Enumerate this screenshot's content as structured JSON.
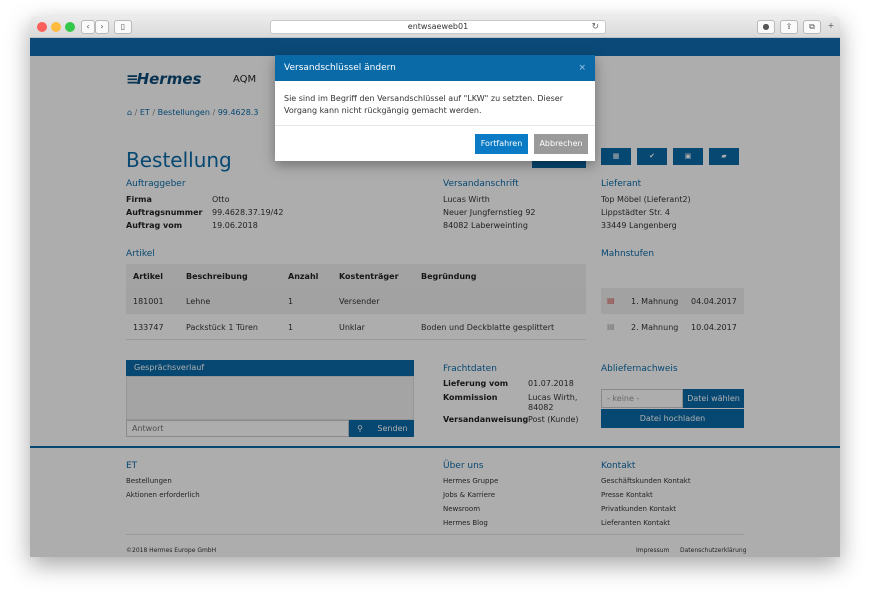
{
  "browser": {
    "url": "entwsaeweb01"
  },
  "header": {
    "logo": "Hermes",
    "app_name": "AQM"
  },
  "breadcrumb": {
    "items": [
      "ET",
      "/",
      "Bestellungen",
      "/",
      "99.4628.3"
    ]
  },
  "page": {
    "title": "Bestellung"
  },
  "auftraggeber": {
    "heading": "Auftraggeber",
    "rows": [
      {
        "label": "Firma",
        "value": "Otto"
      },
      {
        "label": "Auftragsnummer",
        "value": "99.4628.37.19/42"
      },
      {
        "label": "Auftrag vom",
        "value": "19.06.2018"
      }
    ]
  },
  "versandanschrift": {
    "heading": "Versandanschrift",
    "lines": [
      "Lucas Wirth",
      "Neuer Jungfernstieg 92",
      "84082 Laberweinting"
    ]
  },
  "lieferant": {
    "heading": "Lieferant",
    "lines": [
      "Top Möbel (Lieferant2)",
      "Lippstädter Str. 4",
      "33449 Langenberg"
    ]
  },
  "artikel": {
    "heading": "Artikel",
    "columns": [
      "Artikel",
      "Beschreibung",
      "Anzahl",
      "Kostenträger",
      "Begründung"
    ],
    "rows": [
      [
        "181001",
        "Lehne",
        "1",
        "Versender",
        ""
      ],
      [
        "133747",
        "Packstück 1 Türen",
        "1",
        "Unklar",
        "Boden und Deckblatte gesplittert"
      ]
    ]
  },
  "mahnstufen": {
    "heading": "Mahnstufen",
    "rows": [
      {
        "label": "1. Mahnung",
        "date": "04.04.2017"
      },
      {
        "label": "2. Mahnung",
        "date": "10.04.2017"
      }
    ]
  },
  "gespraech": {
    "heading": "Gesprächsverlauf",
    "placeholder": "Antwort",
    "send_label": "Senden"
  },
  "frachtdaten": {
    "heading": "Frachtdaten",
    "rows": [
      {
        "label": "Lieferung vom",
        "value": "01.07.2018"
      },
      {
        "label": "Kommission",
        "value": "Lucas Wirth, 84082"
      },
      {
        "label": "Versandanweisung",
        "value": "Post (Kunde)"
      }
    ]
  },
  "abliefernachweis": {
    "heading": "Abliefernachweis",
    "placeholder": "- keine -",
    "choose_label": "Datei wählen",
    "upload_label": "Datei hochladen"
  },
  "footer": {
    "col1": {
      "heading": "ET",
      "links": [
        "Bestellungen",
        "Aktionen erforderlich"
      ]
    },
    "col2": {
      "heading": "Über uns",
      "links": [
        "Hermes Gruppe",
        "Jobs & Karriere",
        "Newsroom",
        "Hermes Blog"
      ]
    },
    "col3": {
      "heading": "Kontakt",
      "links": [
        "Geschäftskunden Kontakt",
        "Presse Kontakt",
        "Privatkunden Kontakt",
        "Lieferanten Kontakt"
      ]
    },
    "copyright": "©2018 Hermes Europe GmbH",
    "impressum": "Impressum",
    "datenschutz": "Datenschutzerklärung"
  },
  "modal": {
    "title": "Versandschlüssel ändern",
    "close": "×",
    "message": "Sie sind im Begriff den Versandschlüssel auf \"LKW\" zu setzten. Dieser Vorgang kann nicht rückgängig gemacht werden.",
    "continue_label": "Fortfahren",
    "cancel_label": "Abbrechen"
  },
  "colors": {
    "primary": "#0a6aa8",
    "appbar": "#0b4a78",
    "cancel": "#9a9a9a"
  }
}
